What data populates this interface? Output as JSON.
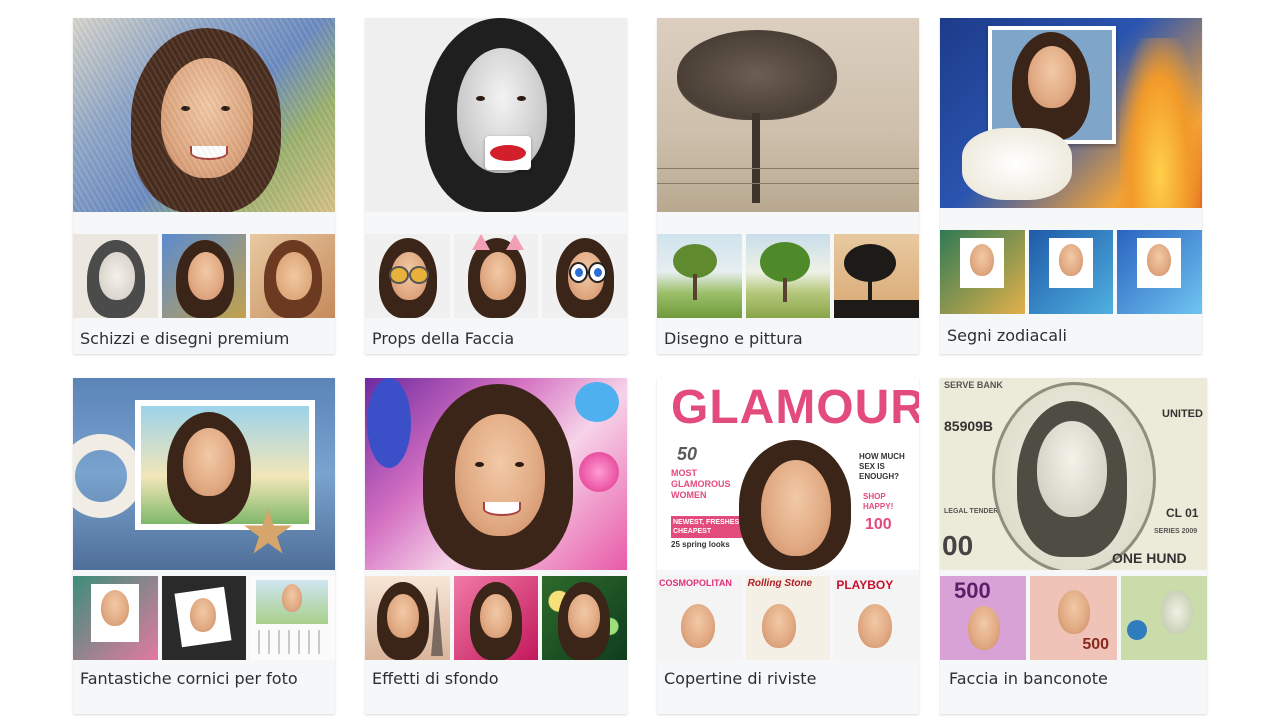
{
  "cards": [
    {
      "label": "Schizzi e disegni premium"
    },
    {
      "label": "Props della Faccia"
    },
    {
      "label": "Disegno e pittura"
    },
    {
      "label": "Segni zodiacali"
    },
    {
      "label": "Fantastiche cornici per foto"
    },
    {
      "label": "Effetti di sfondo"
    },
    {
      "label": "Copertine di riviste"
    },
    {
      "label": "Faccia in banconote"
    }
  ],
  "magazine": {
    "title": "GLAMOUR",
    "issue": "50",
    "cover_left": "MOST GLAMOROUS WOMEN",
    "cover_right": "HOW MUCH SEX IS ENOUGH?",
    "cover_shop": "SHOP HAPPY!",
    "cover_deals": "100",
    "cover_newest": "NEWEST, FRESHEST, CHEAPEST",
    "cover_spring": "25 spring looks",
    "thumb1": "COSMOPOLITAN",
    "thumb2": "Rolling Stone",
    "thumb3": "PLAYBOY"
  },
  "banknote": {
    "serial": "85909B",
    "text_top": "SERVE BANK",
    "text_states": "UNITED",
    "text_legal": "LEGAL TENDER",
    "series": "SERIES 2009",
    "amount_left": "00",
    "denomination_text": "ONE HUND",
    "code": "CL 01",
    "note1": "500",
    "note2": "500"
  },
  "colors": {
    "card_bg": "#f6f7f9",
    "label": "#2b2f36"
  }
}
